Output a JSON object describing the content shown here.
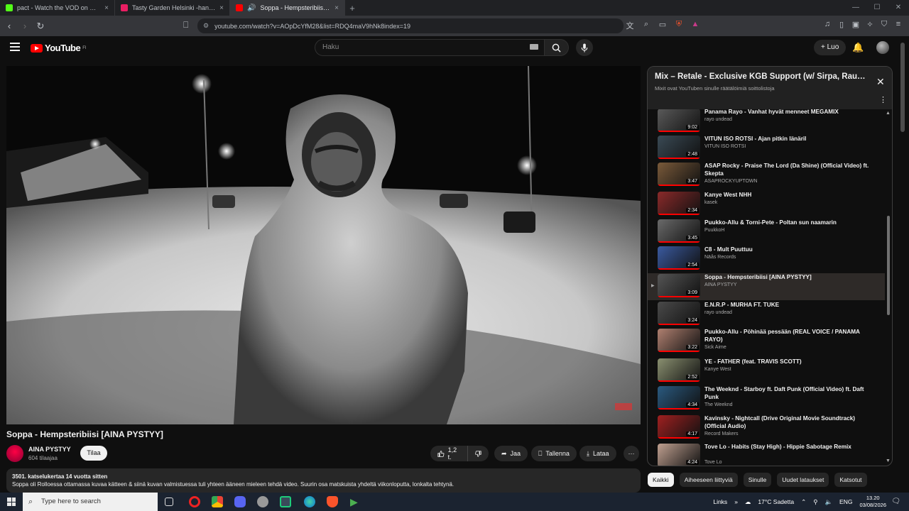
{
  "browser": {
    "tabs": [
      {
        "label": "pact - Watch the VOD on Kick",
        "active": false,
        "favicon_color": "#53fc18"
      },
      {
        "label": "Tasty Garden Helsinki -hankkeessa on",
        "active": false,
        "favicon_color": "#e91e63"
      },
      {
        "label": "Soppa - Hempsteribiisi [AINA",
        "active": true,
        "favicon_color": "#ff0000"
      }
    ],
    "new_tab": "+",
    "url": "youtube.com/watch?v=AOpDcYfM28&list=RDQ4maV9hNk8index=19"
  },
  "youtube": {
    "logo_text": "YouTube",
    "logo_country": "FI",
    "search_placeholder": "Haku",
    "create_label": "+ Luo"
  },
  "video": {
    "title": "Soppa - Hempsteribiisi [AINA PYSTYY]",
    "channel": "AINA PYSTYY",
    "subscribers": "604 tilaajaa",
    "subscribe_label": "Tilaa",
    "likes": "1,2 t.",
    "share_label": "Jaa",
    "save_label": "Tallenna",
    "download_label": "Lataa",
    "more_label": "···",
    "description_stats": "3501. katselukertaa  14 vuotta sitten",
    "description_text": "Soppa oli Rolloessa ottamassa kuvaa kätteen & siinä kuvan valmistuessa tuli yhteen ääneen mieleen tehdä video. Suurin osa matskuista yhdeltä viikonloputta, lonkalta tehtynä."
  },
  "playlist": {
    "title": "Mix – Retale - Exclusive KGB Support (w/ Sirpa, Rautav...",
    "subtitle": "Mixit ovat YouTuben sinulle räätälöimiä soittolistoja",
    "items": [
      {
        "title": "Panama Rayo - Vanhat hyvät menneet MEGAMIX",
        "channel": "rayo undead",
        "duration": "9:02",
        "thumb": "#5a5a5a",
        "current": false
      },
      {
        "title": "VITUN ISO ROTSI - Ajan pitkin länäril",
        "channel": "VITUN ISO ROTSI",
        "duration": "2:48",
        "thumb": "#3a4a55",
        "current": false
      },
      {
        "title": "ASAP Rocky - Praise The Lord (Da Shine) (Official Video) ft. Skepta",
        "channel": "ASAPROCKYUPTOWN",
        "duration": "3:47",
        "thumb": "#7a5a3a",
        "current": false
      },
      {
        "title": "Kanye West NHH",
        "channel": "kasek",
        "duration": "2:34",
        "thumb": "#8a2a2a",
        "current": false
      },
      {
        "title": "Puukko-Allu & Torni-Pete - Poltan sun naamarin",
        "channel": "PuukkoH",
        "duration": "3:45",
        "thumb": "#6a6a6a",
        "current": false
      },
      {
        "title": "C8 - Mult Puuttuu",
        "channel": "Näås Records",
        "duration": "2:54",
        "thumb": "#3a5aa0",
        "current": false
      },
      {
        "title": "Soppa - Hempsteribiisi [AINA PYSTYY]",
        "channel": "AINA PYSTYY",
        "duration": "3:09",
        "thumb": "#555555",
        "current": true
      },
      {
        "title": "E.N.R.P - MURHA FT. TUKE",
        "channel": "rayo undead",
        "duration": "3:24",
        "thumb": "#4a4a4a",
        "current": false
      },
      {
        "title": "Puukko-Allu - Pöhinää pessään (REAL VOICE / PANAMA RAYO)",
        "channel": "Sick Aime",
        "duration": "3:22",
        "thumb": "#b08070",
        "current": false
      },
      {
        "title": "YE - FATHER (feat. TRAVIS SCOTT)",
        "channel": "Kanye West",
        "duration": "2:52",
        "thumb": "#8a9070",
        "current": false
      },
      {
        "title": "The Weeknd - Starboy ft. Daft Punk (Official Video) ft. Daft Punk",
        "channel": "The Weeknd",
        "duration": "4:34",
        "thumb": "#2a5a80",
        "current": false
      },
      {
        "title": "Kavinsky - Nightcall (Drive Original Movie Soundtrack) (Official Audio)",
        "channel": "Record Makers",
        "duration": "4:17",
        "thumb": "#a02020",
        "current": false
      },
      {
        "title": "Tove Lo - Habits (Stay High) - Hippie Sabotage Remix",
        "channel": "Tove Lo",
        "duration": "4:24",
        "thumb": "#c0a090",
        "current": false
      }
    ]
  },
  "chips": [
    {
      "label": "Kaikki",
      "selected": true
    },
    {
      "label": "Aiheeseen liittyviä",
      "selected": false
    },
    {
      "label": "Sinulle",
      "selected": false
    },
    {
      "label": "Uudet lataukset",
      "selected": false
    },
    {
      "label": "Katsotut",
      "selected": false
    }
  ],
  "taskbar": {
    "search_placeholder": "Type here to search",
    "links_label": "Links",
    "weather": "17°C  Sadetta",
    "language": "ENG",
    "time": "13.20",
    "date": "03/08/2026"
  }
}
